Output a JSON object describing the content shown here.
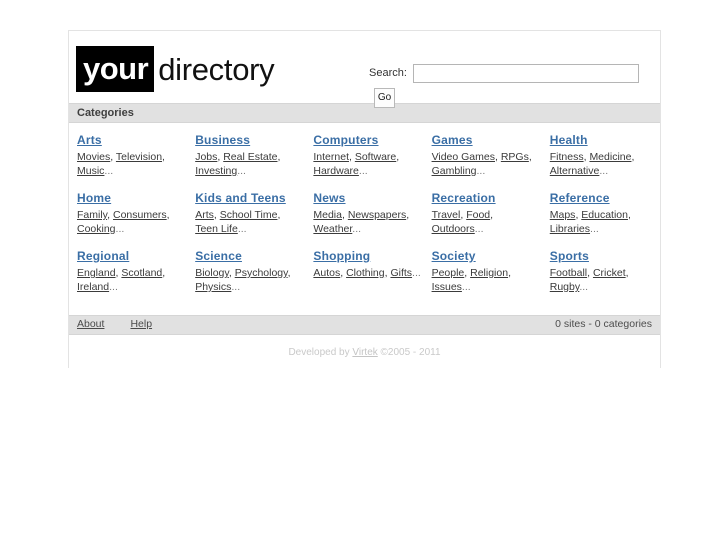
{
  "site": {
    "logo_prefix": "your",
    "logo_suffix": "directory"
  },
  "search": {
    "label": "Search:",
    "value": "",
    "placeholder": "",
    "button_label": "Go"
  },
  "categories_bar": {
    "title": "Categories"
  },
  "categories": [
    [
      {
        "title": "Arts",
        "subs": [
          "Movies",
          "Television",
          "Music"
        ]
      },
      {
        "title": "Business",
        "subs": [
          "Jobs",
          "Real Estate",
          "Investing"
        ]
      },
      {
        "title": "Computers",
        "subs": [
          "Internet",
          "Software",
          "Hardware"
        ]
      },
      {
        "title": "Games",
        "subs": [
          "Video Games",
          "RPGs",
          "Gambling"
        ]
      },
      {
        "title": "Health",
        "subs": [
          "Fitness",
          "Medicine",
          "Alternative"
        ]
      }
    ],
    [
      {
        "title": "Home",
        "subs": [
          "Family",
          "Consumers",
          "Cooking"
        ]
      },
      {
        "title": "Kids and Teens",
        "subs": [
          "Arts",
          "School Time",
          "Teen Life"
        ]
      },
      {
        "title": "News",
        "subs": [
          "Media",
          "Newspapers",
          "Weather"
        ]
      },
      {
        "title": "Recreation",
        "subs": [
          "Travel",
          "Food",
          "Outdoors"
        ]
      },
      {
        "title": "Reference",
        "subs": [
          "Maps",
          "Education",
          "Libraries"
        ]
      }
    ],
    [
      {
        "title": "Regional",
        "subs": [
          "England",
          "Scotland",
          "Ireland"
        ]
      },
      {
        "title": "Science",
        "subs": [
          "Biology",
          "Psychology",
          "Physics"
        ]
      },
      {
        "title": "Shopping",
        "subs": [
          "Autos",
          "Clothing",
          "Gifts"
        ]
      },
      {
        "title": "Society",
        "subs": [
          "People",
          "Religion",
          "Issues"
        ]
      },
      {
        "title": "Sports",
        "subs": [
          "Football",
          "Cricket",
          "Rugby"
        ]
      }
    ]
  ],
  "footer": {
    "links": [
      "About",
      "Help"
    ],
    "stats": "0 sites - 0 categories",
    "credit_prefix": "Developed by ",
    "credit_link": "Virtek",
    "credit_suffix": " ©2005 - 2011"
  },
  "colors": {
    "category_link": "#3a6ea5",
    "bar_background": "#e1e1e1",
    "logo_background": "#000000",
    "credit_text": "#c9c9c9"
  }
}
